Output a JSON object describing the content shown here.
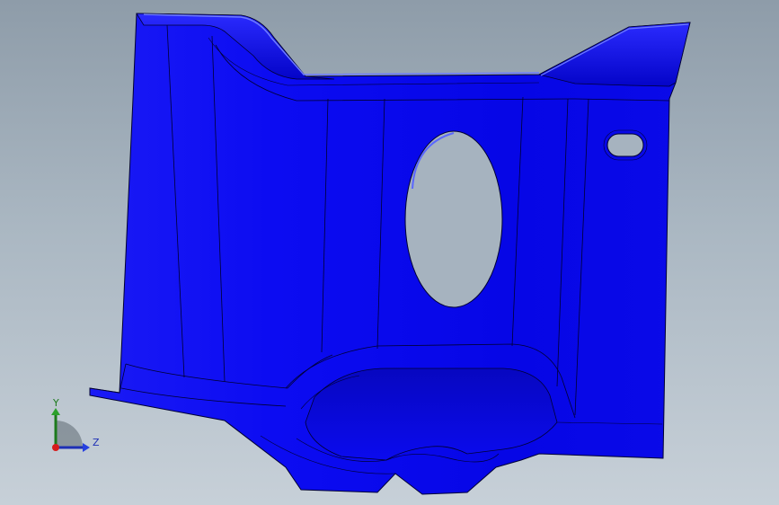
{
  "viewport": {
    "background_top": "#8e9ca9",
    "background_bottom": "#c7d0d8"
  },
  "model": {
    "color": "#0a0af0",
    "edge_color": "#000033",
    "highlight_color": "#6f7dff"
  },
  "triad": {
    "y_label": "Y",
    "z_label": "Z",
    "y_color": "#1c7a1c",
    "z_color": "#1d2fb5",
    "origin_color": "#d61c1c"
  }
}
